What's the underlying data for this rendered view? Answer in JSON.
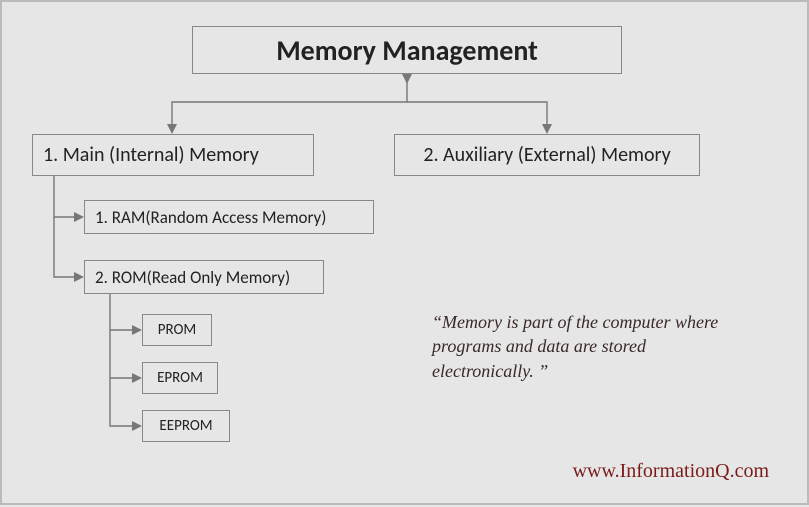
{
  "title": "Memory Management",
  "level1": {
    "main": "1. Main (Internal) Memory",
    "aux": "2. Auxiliary (External) Memory"
  },
  "level2": {
    "ram": "1. RAM(Random Access Memory)",
    "rom": "2. ROM(Read Only Memory)"
  },
  "rom_types": {
    "prom": "PROM",
    "eprom": "EPROM",
    "eeprom": "EEPROM"
  },
  "quote": "“Memory is part of the computer where programs and data are stored electronically. ”",
  "attribution": "www.InformationQ.com"
}
